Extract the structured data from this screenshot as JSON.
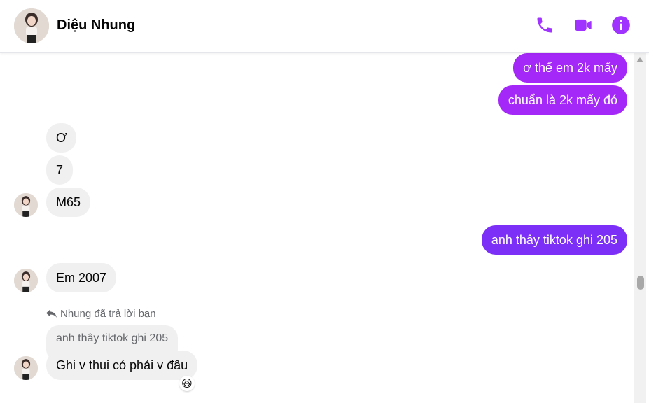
{
  "header": {
    "contact_name": "Diệu Nhung",
    "icons": [
      "phone-icon",
      "video-camera-icon",
      "info-icon"
    ],
    "accent_color": "#a033ff"
  },
  "messages": [
    {
      "sender": "me",
      "text": "ơ thế em 2k mấy",
      "color": "#a428f7"
    },
    {
      "sender": "me",
      "text": "chuẩn là 2k mấy đó",
      "color": "#a428f7"
    },
    {
      "sender": "them",
      "text": "Ơ"
    },
    {
      "sender": "them",
      "text": "7"
    },
    {
      "sender": "them",
      "text": "M65"
    },
    {
      "sender": "me",
      "text": "anh thây tiktok ghi 205",
      "color": "#7b2ff7"
    },
    {
      "sender": "them",
      "text": "Em 2007"
    },
    {
      "sender": "them",
      "text": "Ghi v thui có phải v đâu",
      "reaction": "laughing-emoji"
    }
  ],
  "reply": {
    "note": "Nhung đã trả lời bạn",
    "quoted_text": "anh thây tiktok ghi 205"
  },
  "reaction_glyph": "😆"
}
